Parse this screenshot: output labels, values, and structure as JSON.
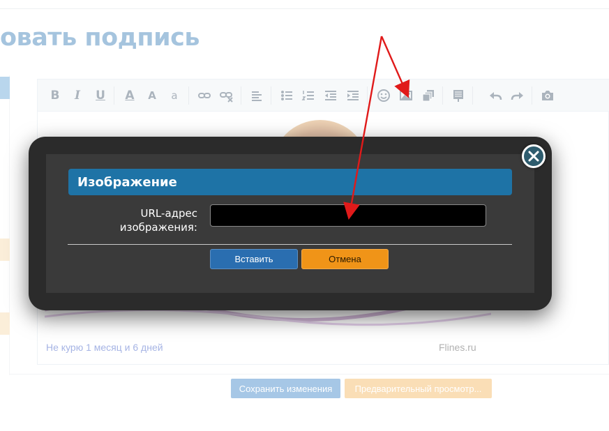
{
  "page": {
    "title": "овать подпись",
    "footer_left": "Не курю 1 месяц и 6 дней",
    "footer_right": "Flines.ru",
    "save_label": "Сохранить изменения",
    "preview_label": "Предварительный просмотр..."
  },
  "toolbar": {
    "bold": "B",
    "italic": "I",
    "underline": "U",
    "text_color": "A",
    "font_size": "A",
    "font_family": "a",
    "icons": [
      "bold-icon",
      "italic-icon",
      "underline-icon",
      "text-color-icon",
      "font-size-icon",
      "font-family-icon",
      "link-icon",
      "unlink-icon",
      "align-icon",
      "bulleted-list-icon",
      "numbered-list-icon",
      "outdent-icon",
      "indent-icon",
      "smiley-icon",
      "image-icon",
      "media-icon",
      "insert-template-icon",
      "undo-icon",
      "redo-icon",
      "camera-icon"
    ]
  },
  "dialog": {
    "title": "Изображение",
    "url_label": "URL-адрес изображения:",
    "url_value": "",
    "insert_label": "Вставить",
    "cancel_label": "Отмена"
  },
  "colors": {
    "header": "#1e73a6",
    "insert": "#2a6eb0",
    "cancel": "#f09418",
    "arrow": "#e01a1a",
    "title": "#2c74b3"
  }
}
